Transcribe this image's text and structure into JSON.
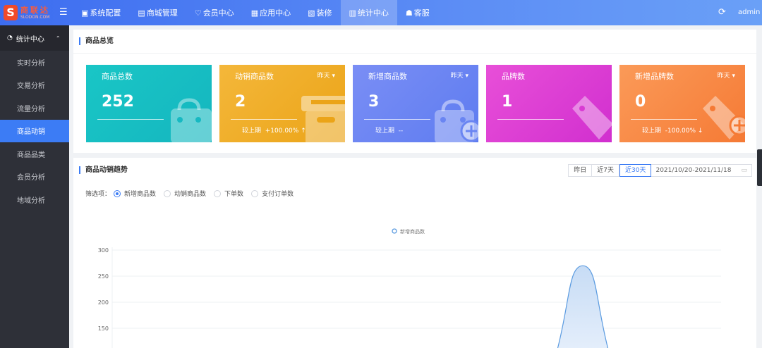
{
  "brand": {
    "mark": "S",
    "name_cn": "商联达",
    "name_en": "SLODON.COM"
  },
  "nav": {
    "items": [
      {
        "label": "系统配置",
        "icon": "settings-icon",
        "glyph": "▣"
      },
      {
        "label": "商城管理",
        "icon": "shop-icon",
        "glyph": "▤"
      },
      {
        "label": "会员中心",
        "icon": "member-icon",
        "glyph": "♡"
      },
      {
        "label": "应用中心",
        "icon": "apps-icon",
        "glyph": "▦"
      },
      {
        "label": "装修",
        "icon": "decorate-icon",
        "glyph": "▧"
      },
      {
        "label": "统计中心",
        "icon": "stats-icon",
        "glyph": "▥"
      },
      {
        "label": "客服",
        "icon": "service-icon",
        "glyph": "☗"
      }
    ],
    "active": "统计中心",
    "user": "admin"
  },
  "sidebar": {
    "title": "统计中心",
    "items": [
      "实时分析",
      "交易分析",
      "流量分析",
      "商品动销",
      "商品品类",
      "会员分析",
      "地域分析"
    ],
    "active": "商品动销"
  },
  "overview": {
    "title": "商品总览",
    "cards": [
      {
        "name": "商品总数",
        "period": "",
        "value": "252",
        "compare_label": "",
        "compare_value": "",
        "trend": "",
        "color": "#19c6c6",
        "icon": "bag-icon"
      },
      {
        "name": "动销商品数",
        "period": "昨天",
        "value": "2",
        "compare_label": "较上期",
        "compare_value": "+100.00%",
        "trend": "↑",
        "color": "#f4b73a",
        "icon": "box-icon"
      },
      {
        "name": "新增商品数",
        "period": "昨天",
        "value": "3",
        "compare_label": "较上期",
        "compare_value": "--",
        "trend": "",
        "color": "#7a8ef5",
        "icon": "bag-plus-icon"
      },
      {
        "name": "品牌数",
        "period": "",
        "value": "1",
        "compare_label": "",
        "compare_value": "",
        "trend": "",
        "color": "#e84fd8",
        "icon": "tag-icon"
      },
      {
        "name": "新增品牌数",
        "period": "昨天",
        "value": "0",
        "compare_label": "较上期",
        "compare_value": "-100.00%",
        "trend": "↓",
        "color": "#fb9a58",
        "icon": "tag-plus-icon"
      }
    ]
  },
  "trend": {
    "title": "商品动销趋势",
    "date_buttons": [
      "昨日",
      "近7天",
      "近30天"
    ],
    "active_range": "近30天",
    "date_range": "2021/10/20-2021/11/18",
    "filter_label": "筛选项：",
    "filters": [
      "新增商品数",
      "动销商品数",
      "下单数",
      "支付订单数"
    ],
    "selected_filter": "新增商品数"
  },
  "chart_data": {
    "type": "area",
    "legend": [
      "新增商品数"
    ],
    "legend_position": "top-center",
    "y_ticks": [
      150,
      200,
      250,
      300
    ],
    "ylim": [
      150,
      300
    ],
    "grid": true,
    "series": [
      {
        "name": "新增商品数",
        "color": "#5b9be0",
        "peak_value": 270
      }
    ]
  }
}
